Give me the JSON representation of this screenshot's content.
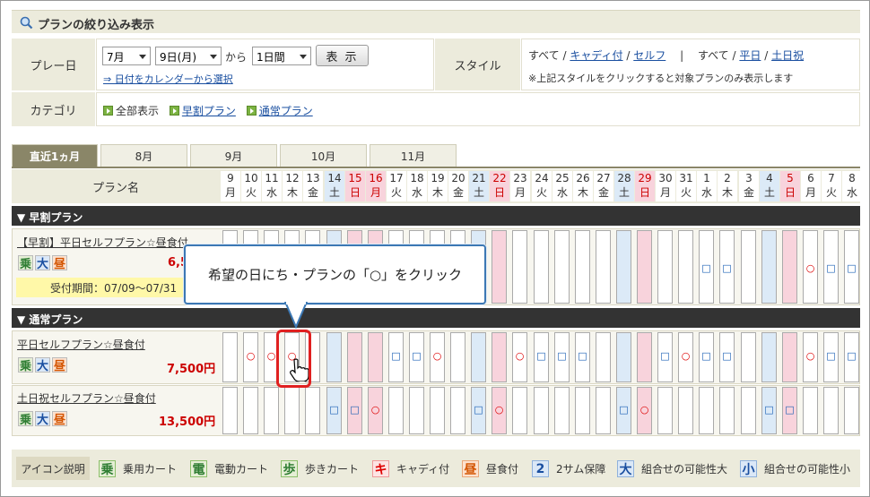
{
  "header": {
    "title": "プランの絞り込み表示"
  },
  "filter": {
    "play_date_label": "プレー日",
    "month_value": "7月",
    "day_value": "9日(月)",
    "from_text": "から",
    "duration_value": "1日間",
    "show_button": "表 示",
    "calendar_link": "⇒ 日付をカレンダーから選択",
    "style_label": "スタイル",
    "style_all1": "すべて",
    "style_caddie": "キャディ付",
    "style_self": "セルフ",
    "style_sep": "|",
    "style_all2": "すべて",
    "style_weekday": "平日",
    "style_holiday": "土日祝",
    "slash": "/",
    "style_note": "※上記スタイルをクリックすると対象プランのみ表示します",
    "category_label": "カテゴリ",
    "cat_all": "全部表示",
    "cat_early": "早割プラン",
    "cat_normal": "通常プラン"
  },
  "tabs": [
    "直近1ヵ月",
    "8月",
    "9月",
    "10月",
    "11月"
  ],
  "grid": {
    "plan_name_header": "プラン名",
    "days": [
      {
        "n": "9",
        "w": "月",
        "t": ""
      },
      {
        "n": "10",
        "w": "火",
        "t": ""
      },
      {
        "n": "11",
        "w": "水",
        "t": ""
      },
      {
        "n": "12",
        "w": "木",
        "t": ""
      },
      {
        "n": "13",
        "w": "金",
        "t": ""
      },
      {
        "n": "14",
        "w": "土",
        "t": "sat"
      },
      {
        "n": "15",
        "w": "日",
        "t": "sun"
      },
      {
        "n": "16",
        "w": "月",
        "t": "sun"
      },
      {
        "n": "17",
        "w": "火",
        "t": ""
      },
      {
        "n": "18",
        "w": "水",
        "t": ""
      },
      {
        "n": "19",
        "w": "木",
        "t": ""
      },
      {
        "n": "20",
        "w": "金",
        "t": ""
      },
      {
        "n": "21",
        "w": "土",
        "t": "sat"
      },
      {
        "n": "22",
        "w": "日",
        "t": "sun"
      },
      {
        "n": "23",
        "w": "月",
        "t": ""
      },
      {
        "n": "24",
        "w": "火",
        "t": ""
      },
      {
        "n": "25",
        "w": "水",
        "t": ""
      },
      {
        "n": "26",
        "w": "木",
        "t": ""
      },
      {
        "n": "27",
        "w": "金",
        "t": ""
      },
      {
        "n": "28",
        "w": "土",
        "t": "sat"
      },
      {
        "n": "29",
        "w": "日",
        "t": "sun"
      },
      {
        "n": "30",
        "w": "月",
        "t": ""
      },
      {
        "n": "31",
        "w": "火",
        "t": ""
      },
      {
        "n": "1",
        "w": "水",
        "t": ""
      },
      {
        "n": "2",
        "w": "木",
        "t": ""
      },
      {
        "n": "3",
        "w": "金",
        "t": ""
      },
      {
        "n": "4",
        "w": "土",
        "t": "sat"
      },
      {
        "n": "5",
        "w": "日",
        "t": "sun"
      },
      {
        "n": "6",
        "w": "月",
        "t": ""
      },
      {
        "n": "7",
        "w": "火",
        "t": ""
      },
      {
        "n": "8",
        "w": "水",
        "t": ""
      }
    ],
    "section_early": "▼ 早割プラン",
    "section_normal": "▼ 通常プラン",
    "plans": [
      {
        "name": "【早割】平日セルフプラン☆昼食付",
        "price": "6,5",
        "period": "受付期間：07/09〜07/31",
        "icons": [
          "乗",
          "大",
          "昼"
        ],
        "marks": [
          "",
          "",
          "",
          "",
          "",
          "",
          "",
          "",
          "",
          "",
          "",
          "",
          "",
          "",
          "",
          "",
          "",
          "",
          "",
          "",
          "",
          "",
          "",
          "□",
          "□",
          "",
          "",
          "",
          "○",
          "□",
          "□"
        ]
      },
      {
        "name": "平日セルフプラン☆昼食付",
        "price": "7,500円",
        "icons": [
          "乗",
          "大",
          "昼"
        ],
        "marks": [
          "",
          "○",
          "○",
          "○",
          "",
          "",
          "",
          "",
          "□",
          "□",
          "○",
          "",
          "",
          "",
          "○",
          "□",
          "□",
          "□",
          "",
          "",
          "",
          "□",
          "○",
          "□",
          "□",
          "",
          "",
          "",
          "○",
          "□",
          "□"
        ]
      },
      {
        "name": "土日祝セルフプラン☆昼食付",
        "price": "13,500円",
        "icons": [
          "乗",
          "大",
          "昼"
        ],
        "marks": [
          "",
          "",
          "",
          "",
          "",
          "□",
          "□",
          "○",
          "",
          "",
          "",
          "",
          "□",
          "○",
          "",
          "",
          "",
          "",
          "",
          "□",
          "○",
          "",
          "",
          "",
          "",
          "",
          "□",
          "□",
          "",
          "",
          ""
        ]
      }
    ]
  },
  "callout": {
    "text": "希望の日にち・プランの「○」をクリック"
  },
  "legend": {
    "title": "アイコン説明",
    "items": [
      {
        "icon": "乗",
        "label": "乗用カート"
      },
      {
        "icon": "電",
        "label": "電動カート"
      },
      {
        "icon": "歩",
        "label": "歩きカート"
      },
      {
        "icon": "キ",
        "label": "キャディ付"
      },
      {
        "icon": "昼",
        "label": "昼食付"
      },
      {
        "icon": "2",
        "label": "2サム保障"
      },
      {
        "icon": "大",
        "label": "組合せの可能性大"
      },
      {
        "icon": "小",
        "label": "組合せの可能性小"
      }
    ]
  }
}
